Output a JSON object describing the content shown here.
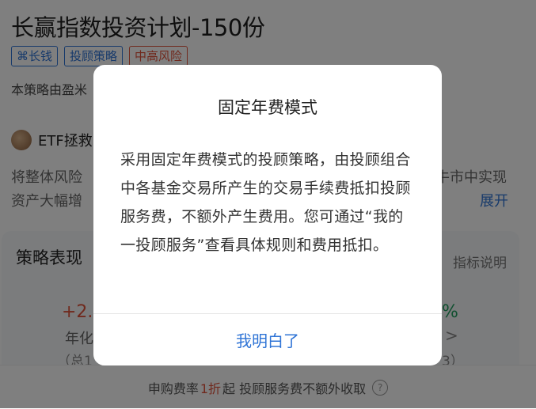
{
  "header": {
    "title": "长赢指数投资计划-150份",
    "tags": [
      {
        "label": "⌘长钱"
      },
      {
        "label": "投顾策略"
      },
      {
        "label": "中高风险"
      }
    ],
    "description": "本策略由盈米"
  },
  "author": {
    "name": "ETF拯救"
  },
  "intro": {
    "line1_left": "将整体风险",
    "line1_right": "牛市中实现",
    "line2_left": "资产大幅增",
    "expand_label": "展开"
  },
  "performance": {
    "title": "策略表现",
    "indicator_link": "指标说明",
    "left_value": "+2.",
    "left_label": "年化",
    "left_sub": "（总1",
    "right_value": "%",
    "right_arrow": ">",
    "right_sub": "3）"
  },
  "bottom_bar": {
    "prefix": "申购费率",
    "highlight": "1折",
    "suffix": "起 投顾服务费不额外收取",
    "help_icon": "?"
  },
  "modal": {
    "title": "固定年费模式",
    "body": "采用固定年费模式的投顾策略，由投顾组合中各基金交易所产生的交易手续费抵扣投顾服务费，不额外产生费用。您可通过“我的一投顾服务”查看具体规则和费用抵扣。",
    "confirm_label": "我明白了"
  },
  "colors": {
    "accent_blue": "#2f74d6",
    "risk_red": "#e0533b",
    "positive_green": "#20a060",
    "overlay": "rgba(0,0,0,0.5)"
  }
}
